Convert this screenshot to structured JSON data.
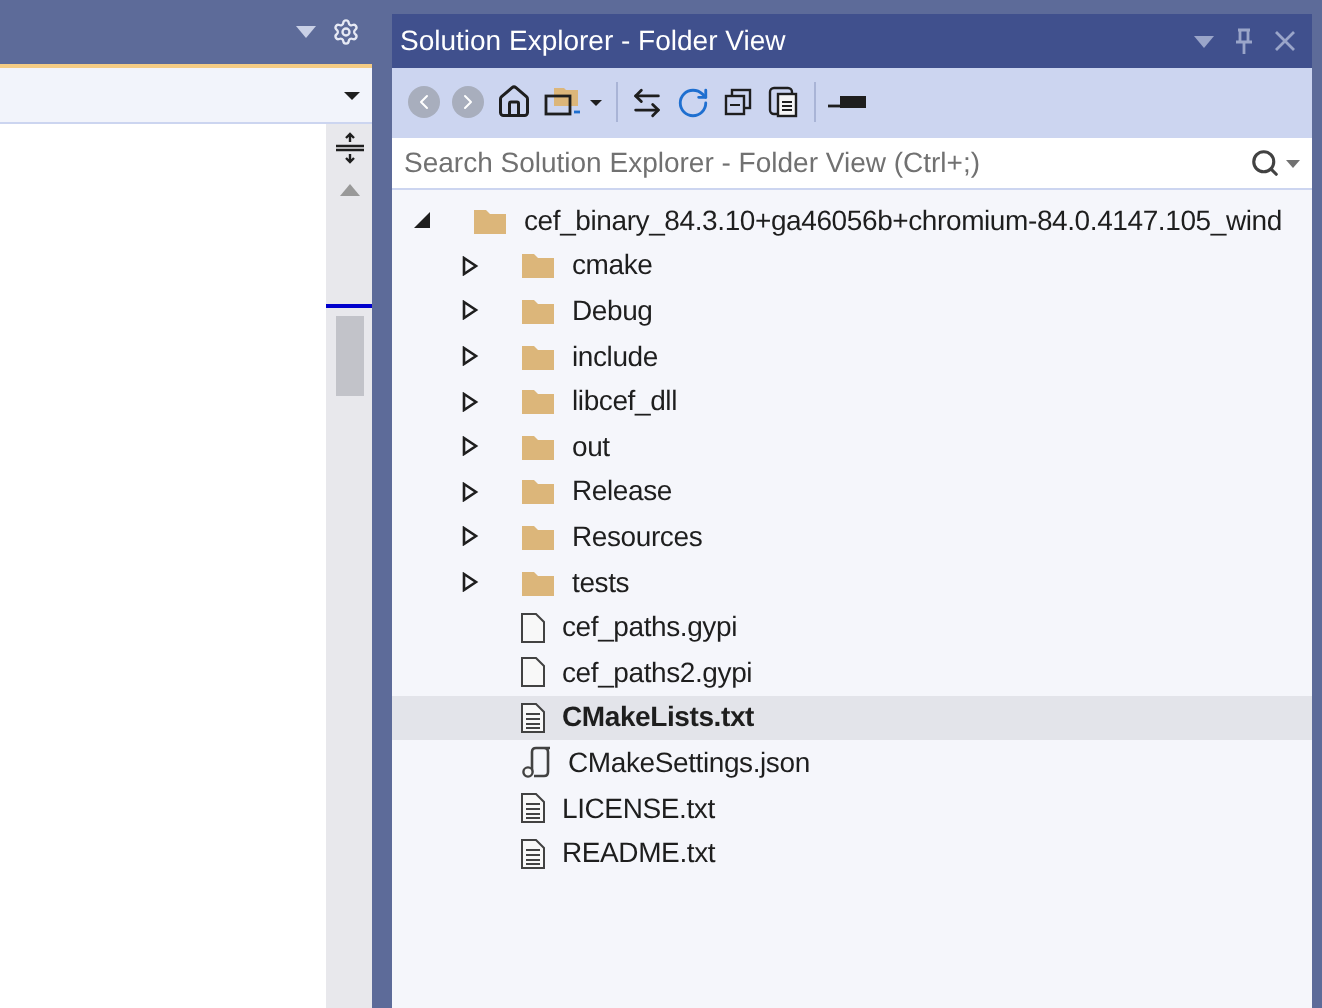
{
  "panel": {
    "title": "Solution Explorer - Folder View"
  },
  "toolbar": {
    "back_disabled": true,
    "forward_disabled": true
  },
  "search": {
    "placeholder": "Search Solution Explorer - Folder View (Ctrl+;)"
  },
  "tree": [
    {
      "kind": "folder",
      "label": "cef_binary_84.3.10+ga46056b+chromium-84.0.4147.105_wind",
      "expanded": true,
      "selected": false,
      "children": [
        {
          "kind": "folder",
          "label": "cmake",
          "expanded": false,
          "selected": false
        },
        {
          "kind": "folder",
          "label": "Debug",
          "expanded": false,
          "selected": false
        },
        {
          "kind": "folder",
          "label": "include",
          "expanded": false,
          "selected": false
        },
        {
          "kind": "folder",
          "label": "libcef_dll",
          "expanded": false,
          "selected": false
        },
        {
          "kind": "folder",
          "label": "out",
          "expanded": false,
          "selected": false
        },
        {
          "kind": "folder",
          "label": "Release",
          "expanded": false,
          "selected": false
        },
        {
          "kind": "folder",
          "label": "Resources",
          "expanded": false,
          "selected": false
        },
        {
          "kind": "folder",
          "label": "tests",
          "expanded": false,
          "selected": false
        },
        {
          "kind": "file",
          "label": "cef_paths.gypi",
          "selected": false
        },
        {
          "kind": "file",
          "label": "cef_paths2.gypi",
          "selected": false
        },
        {
          "kind": "text",
          "label": "CMakeLists.txt",
          "selected": true
        },
        {
          "kind": "settings",
          "label": "CMakeSettings.json",
          "selected": false
        },
        {
          "kind": "text",
          "label": "LICENSE.txt",
          "selected": false
        },
        {
          "kind": "text",
          "label": "README.txt",
          "selected": false
        }
      ]
    }
  ]
}
